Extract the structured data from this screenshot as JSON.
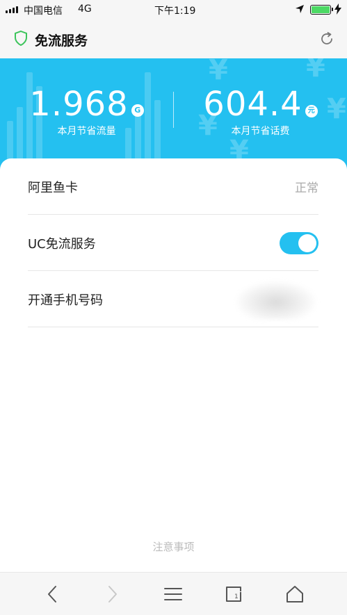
{
  "status_bar": {
    "carrier": "中国电信",
    "network": "4G",
    "time": "下午1:19",
    "icons": [
      "signal-icon",
      "location-arrow-icon",
      "battery-icon",
      "charging-icon"
    ],
    "battery_color": "#4cd964"
  },
  "header": {
    "title": "免流服务",
    "icons": [
      "shield-icon",
      "refresh-icon"
    ]
  },
  "hero": {
    "background_color": "#24c0f0",
    "data_saved": {
      "value": "1.968",
      "unit": "G",
      "label": "本月节省流量"
    },
    "fee_saved": {
      "value": "604.4",
      "unit": "元",
      "label": "本月节省话费"
    }
  },
  "settings": [
    {
      "label": "阿里鱼卡",
      "value": "正常"
    },
    {
      "label": "UC免流服务",
      "toggle_on": true
    },
    {
      "label": "开通手机号码",
      "value_obscured": true
    }
  ],
  "notice": "注意事项",
  "bottom_nav": {
    "icons": [
      "back-arrow-icon",
      "forward-arrow-icon",
      "menu-icon",
      "tabs-icon",
      "home-icon"
    ]
  },
  "colors": {
    "accent": "#24c0f0",
    "muted_text": "#aaaaaa"
  }
}
